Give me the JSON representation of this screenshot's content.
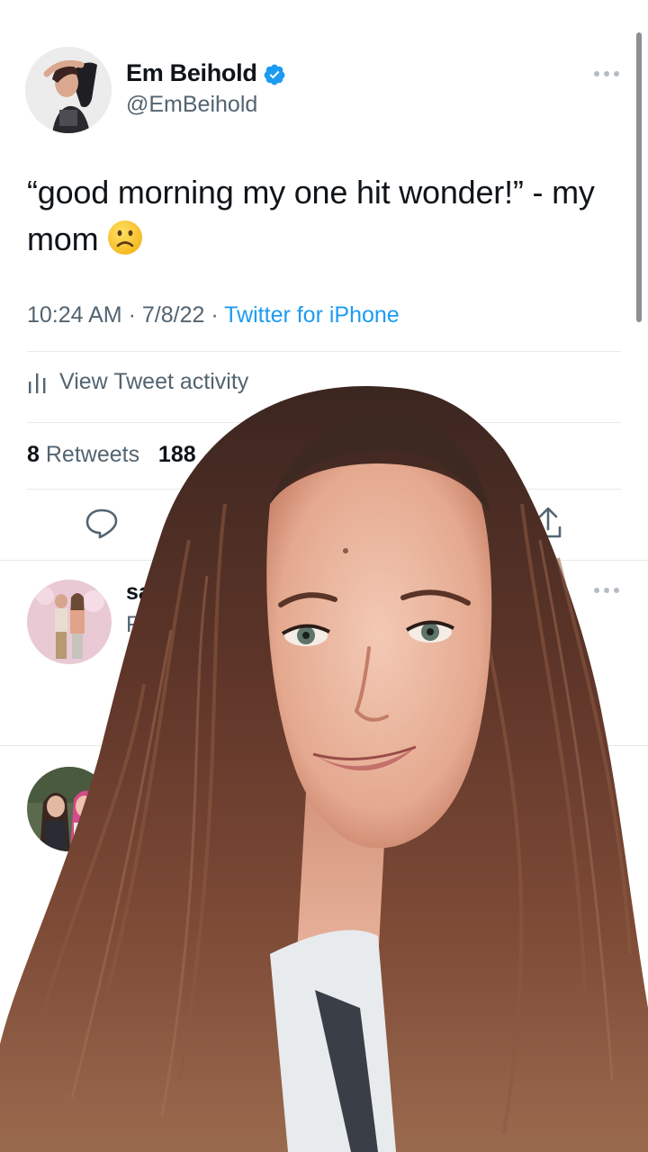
{
  "tweet": {
    "author": {
      "display_name": "Em Beihold",
      "handle": "@EmBeihold",
      "verified": true
    },
    "text": "“good morning my one hit wonder!” - my mom",
    "emoji": "frowning-face",
    "time": "10:24 AM",
    "date": "7/8/22",
    "source": "Twitter for iPhone",
    "activity_label": "View Tweet activity",
    "stats": {
      "retweets_count": "8",
      "retweets_label": "Retweets",
      "likes_count_partial": "188"
    }
  },
  "replies": [
    {
      "name_partial": "sa",
      "sub_partial": "R"
    }
  ],
  "colors": {
    "link_blue": "#1d9bf0",
    "secondary_text": "#536471",
    "primary_text": "#0f1419",
    "verified_blue": "#1d9bf0",
    "divider": "#e6e9eb",
    "overlay_hair": "#6b3a2a"
  },
  "overlay": {
    "type": "person-cutout-greenscreen"
  }
}
